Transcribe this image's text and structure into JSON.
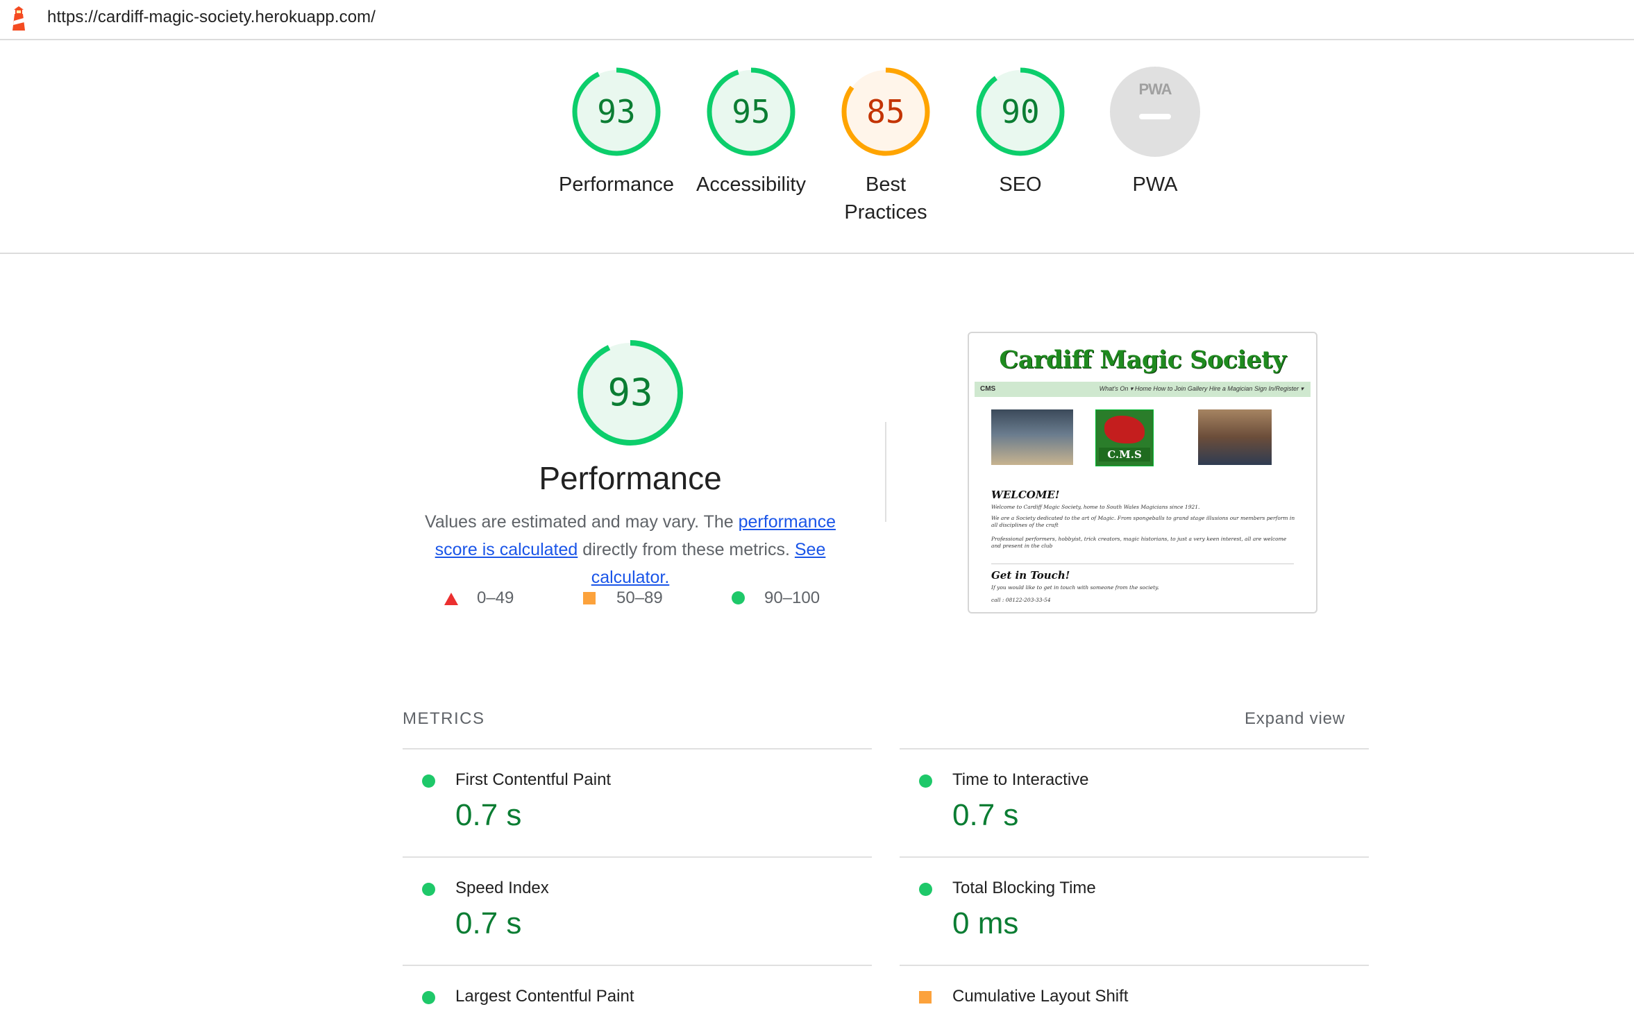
{
  "toolbar": {
    "url": "https://cardiff-magic-society.herokuapp.com/",
    "logo_icon": "lighthouse-icon"
  },
  "gauges": [
    {
      "label": "Performance",
      "score": "93",
      "value": 93,
      "color": "#0cce6b",
      "fill": "#e9f8ef",
      "text": "#0b7d33"
    },
    {
      "label": "Accessibility",
      "score": "95",
      "value": 95,
      "color": "#0cce6b",
      "fill": "#e9f8ef",
      "text": "#0b7d33"
    },
    {
      "label": "Best Practices",
      "score": "85",
      "value": 85,
      "color": "#ffa400",
      "fill": "#fff5ea",
      "text": "#c33300"
    },
    {
      "label": "SEO",
      "score": "90",
      "value": 90,
      "color": "#0cce6b",
      "fill": "#e9f8ef",
      "text": "#0b7d33"
    },
    {
      "label": "PWA",
      "badge": "PWA",
      "icon": "pwa-badge-icon"
    }
  ],
  "performance": {
    "score": "93",
    "value": 93,
    "title": "Performance",
    "desc_prefix": "Values are estimated and may vary. The ",
    "link1": "performance score is calculated",
    "desc_middle": " directly from these metrics. ",
    "link2": "See calculator.",
    "legend": [
      {
        "range": "0–49",
        "icon": "fail-triangle-icon",
        "color": "#eb2f2f"
      },
      {
        "range": "50–89",
        "icon": "average-square-icon",
        "color": "#fca23c"
      },
      {
        "range": "90–100",
        "icon": "pass-circle-icon",
        "color": "#1ec869"
      }
    ]
  },
  "screenshot": {
    "site_title": "Cardiff Magic Society",
    "nav_brand": "CMS",
    "nav_links": "What's On ▾   Home   How to Join   Gallery   Hire a Magician   Sign In/Register ▾",
    "logo_text": "C.M.S",
    "welcome": "WELCOME!",
    "p1": "Welcome to Cardiff Magic Society, home to South Wales Magicians since 1921.",
    "p2": "We are a Society dedicated to the art of Magic. From spongeballs to grand stage illusions our members perform in all disciplines of the craft",
    "p3": "Professional performers, hobbyist, trick creators, magic historians, to just a very keen interest, all are welcome and present in the club",
    "touch": "Get in Touch!",
    "p4": "If you would like to get in touch with someone from the society.",
    "p5": "call : 08122-203-33-54"
  },
  "metrics": {
    "heading": "METRICS",
    "expand": "Expand view",
    "items": [
      {
        "title": "First Contentful Paint",
        "value": "0.7 s",
        "status": "pass"
      },
      {
        "title": "Time to Interactive",
        "value": "0.7 s",
        "status": "pass"
      },
      {
        "title": "Speed Index",
        "value": "0.7 s",
        "status": "pass"
      },
      {
        "title": "Total Blocking Time",
        "value": "0 ms",
        "status": "pass"
      },
      {
        "title": "Largest Contentful Paint",
        "value": "",
        "status": "pass"
      },
      {
        "title": "Cumulative Layout Shift",
        "value": "",
        "status": "average"
      }
    ]
  }
}
